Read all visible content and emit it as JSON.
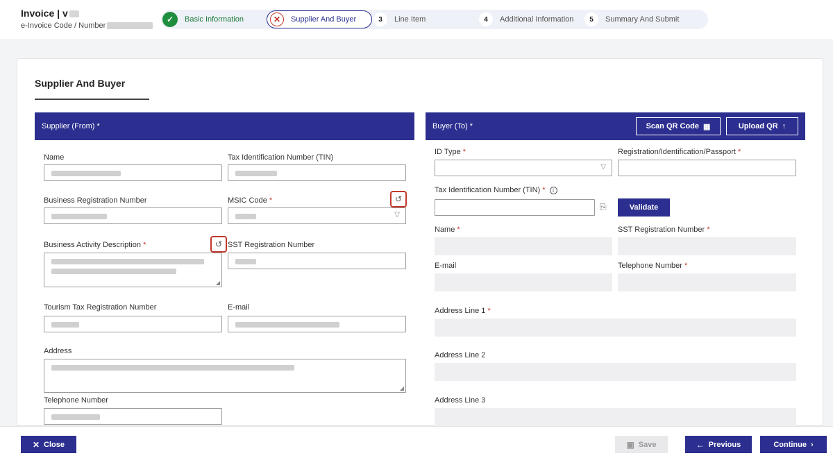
{
  "header": {
    "title": "Invoice | v",
    "subtitle": "e-Invoice Code / Number"
  },
  "steps": [
    {
      "num": "✓",
      "label": "Basic Information"
    },
    {
      "num": "✕",
      "label": "Supplier And Buyer"
    },
    {
      "num": "3",
      "label": "Line Item"
    },
    {
      "num": "4",
      "label": "Additional Information"
    },
    {
      "num": "5",
      "label": "Summary And Submit"
    }
  ],
  "section": {
    "title": "Supplier And Buyer"
  },
  "supplier": {
    "heading": "Supplier (From) *",
    "fields": {
      "name": "Name",
      "tin": "Tax Identification Number (TIN)",
      "brn": "Business Registration Number",
      "msic": "MSIC Code",
      "bad": "Business Activity Description",
      "sst": "SST Registration Number",
      "tourism": "Tourism Tax Registration Number",
      "email": "E-mail",
      "address": "Address",
      "phone": "Telephone Number"
    }
  },
  "buyer": {
    "heading": "Buyer (To) *",
    "scan_qr": "Scan QR Code",
    "upload_qr": "Upload QR",
    "fields": {
      "id_type": "ID Type",
      "reg_id": "Registration/Identification/Passport",
      "tin": "Tax Identification Number (TIN)",
      "validate": "Validate",
      "name": "Name",
      "sst": "SST Registration Number",
      "email": "E-mail",
      "phone": "Telephone Number",
      "addr1": "Address Line 1",
      "addr2": "Address Line 2",
      "addr3": "Address Line 3"
    }
  },
  "footer": {
    "close": "Close",
    "save": "Save",
    "previous": "Previous",
    "continue": "Continue"
  },
  "colors": {
    "primary": "#2c2f8f",
    "success": "#1e8e3e",
    "danger": "#c0392b"
  }
}
